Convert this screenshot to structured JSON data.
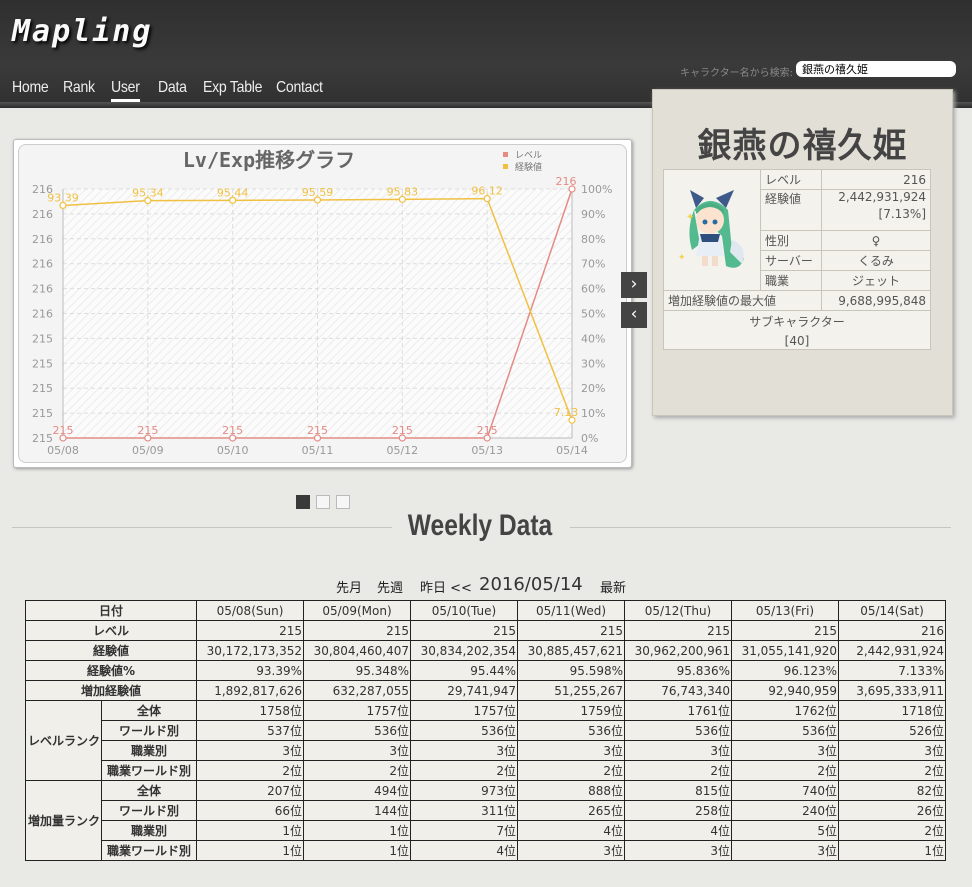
{
  "site": {
    "logo": "Mapling"
  },
  "nav": [
    {
      "label": "Home"
    },
    {
      "label": "Rank"
    },
    {
      "label": "User"
    },
    {
      "label": "Data"
    },
    {
      "label": "Exp Table"
    },
    {
      "label": "Contact"
    }
  ],
  "search": {
    "label": "キャラクター名から検索:",
    "value": "銀燕の禧久姫"
  },
  "chart_data": {
    "type": "line",
    "title": "Lv/Exp推移グラフ",
    "categories": [
      "05/08",
      "05/09",
      "05/10",
      "05/11",
      "05/12",
      "05/13",
      "05/14"
    ],
    "series": [
      {
        "name": "レベル",
        "axis": "left",
        "color": "#e38b84",
        "values": [
          215,
          215,
          215,
          215,
          215,
          215,
          216
        ],
        "point_labels": [
          "215",
          "215",
          "215",
          "215",
          "215",
          "215",
          "216"
        ]
      },
      {
        "name": "経験値",
        "axis": "right",
        "color": "#f0c041",
        "values": [
          93.39,
          95.34,
          95.44,
          95.59,
          95.83,
          96.12,
          7.13
        ],
        "point_labels": [
          "93.39",
          "95.34",
          "95.44",
          "95.59",
          "95.83",
          "96.12",
          "7.13"
        ]
      }
    ],
    "y_left_ticks": [
      "216",
      "216",
      "216",
      "216",
      "216",
      "216",
      "215",
      "215",
      "215",
      "215",
      "215"
    ],
    "y_left_range": [
      215,
      216
    ],
    "y_right_ticks": [
      "100%",
      "90%",
      "80%",
      "70%",
      "60%",
      "50%",
      "40%",
      "30%",
      "20%",
      "10%",
      "0%"
    ],
    "y_right_range": [
      0,
      100
    ],
    "legend": "top-right",
    "grid": true
  },
  "carousel": {
    "next": "›",
    "prev": "‹"
  },
  "profile": {
    "name": "銀燕の禧久姫",
    "rows": [
      {
        "key": "レベル",
        "value": "216"
      },
      {
        "key": "経験値",
        "value": "2,442,931,924",
        "sub": "[7.13%]"
      },
      {
        "key": "性別",
        "value": "♀"
      },
      {
        "key": "サーバー",
        "value": "くるみ"
      },
      {
        "key": "職業",
        "value": "ジェット"
      }
    ],
    "max_gain_label": "増加経験値の最大値",
    "max_gain_value": "9,688,995,848",
    "sub_label": "サブキャラクター",
    "sub_value": "[40]"
  },
  "weekly": {
    "title": "Weekly Data",
    "nav": {
      "prev_month": "先月",
      "prev_week": "先週",
      "yesterday": "昨日 <<",
      "date": "2016/05/14",
      "latest": "最新"
    },
    "header_label": "日付",
    "dates": [
      "05/08(Sun)",
      "05/09(Mon)",
      "05/10(Tue)",
      "05/11(Wed)",
      "05/12(Thu)",
      "05/13(Fri)",
      "05/14(Sat)"
    ],
    "rows": [
      {
        "label": "レベル",
        "values": [
          "215",
          "215",
          "215",
          "215",
          "215",
          "215",
          "216"
        ]
      },
      {
        "label": "経験値",
        "values": [
          "30,172,173,352",
          "30,804,460,407",
          "30,834,202,354",
          "30,885,457,621",
          "30,962,200,961",
          "31,055,141,920",
          "2,442,931,924"
        ]
      },
      {
        "label": "経験値%",
        "values": [
          "93.39%",
          "95.348%",
          "95.44%",
          "95.598%",
          "95.836%",
          "96.123%",
          "7.133%"
        ]
      },
      {
        "label": "増加経験値",
        "values": [
          "1,892,817,626",
          "632,287,055",
          "29,741,947",
          "51,255,267",
          "76,743,340",
          "92,940,959",
          "3,695,333,911"
        ]
      }
    ],
    "groups": [
      {
        "label": "レベルランク",
        "rows": [
          {
            "label": "全体",
            "values": [
              "1758位",
              "1757位",
              "1757位",
              "1759位",
              "1761位",
              "1762位",
              "1718位"
            ]
          },
          {
            "label": "ワールド別",
            "values": [
              "537位",
              "536位",
              "536位",
              "536位",
              "536位",
              "536位",
              "526位"
            ]
          },
          {
            "label": "職業別",
            "values": [
              "3位",
              "3位",
              "3位",
              "3位",
              "3位",
              "3位",
              "3位"
            ]
          },
          {
            "label": "職業ワールド別",
            "values": [
              "2位",
              "2位",
              "2位",
              "2位",
              "2位",
              "2位",
              "2位"
            ]
          }
        ]
      },
      {
        "label": "増加量ランク",
        "rows": [
          {
            "label": "全体",
            "values": [
              "207位",
              "494位",
              "973位",
              "888位",
              "815位",
              "740位",
              "82位"
            ]
          },
          {
            "label": "ワールド別",
            "values": [
              "66位",
              "144位",
              "311位",
              "265位",
              "258位",
              "240位",
              "26位"
            ]
          },
          {
            "label": "職業別",
            "values": [
              "1位",
              "1位",
              "7位",
              "4位",
              "4位",
              "5位",
              "2位"
            ]
          },
          {
            "label": "職業ワールド別",
            "values": [
              "1位",
              "1位",
              "4位",
              "3位",
              "3位",
              "3位",
              "1位"
            ]
          }
        ]
      }
    ]
  }
}
